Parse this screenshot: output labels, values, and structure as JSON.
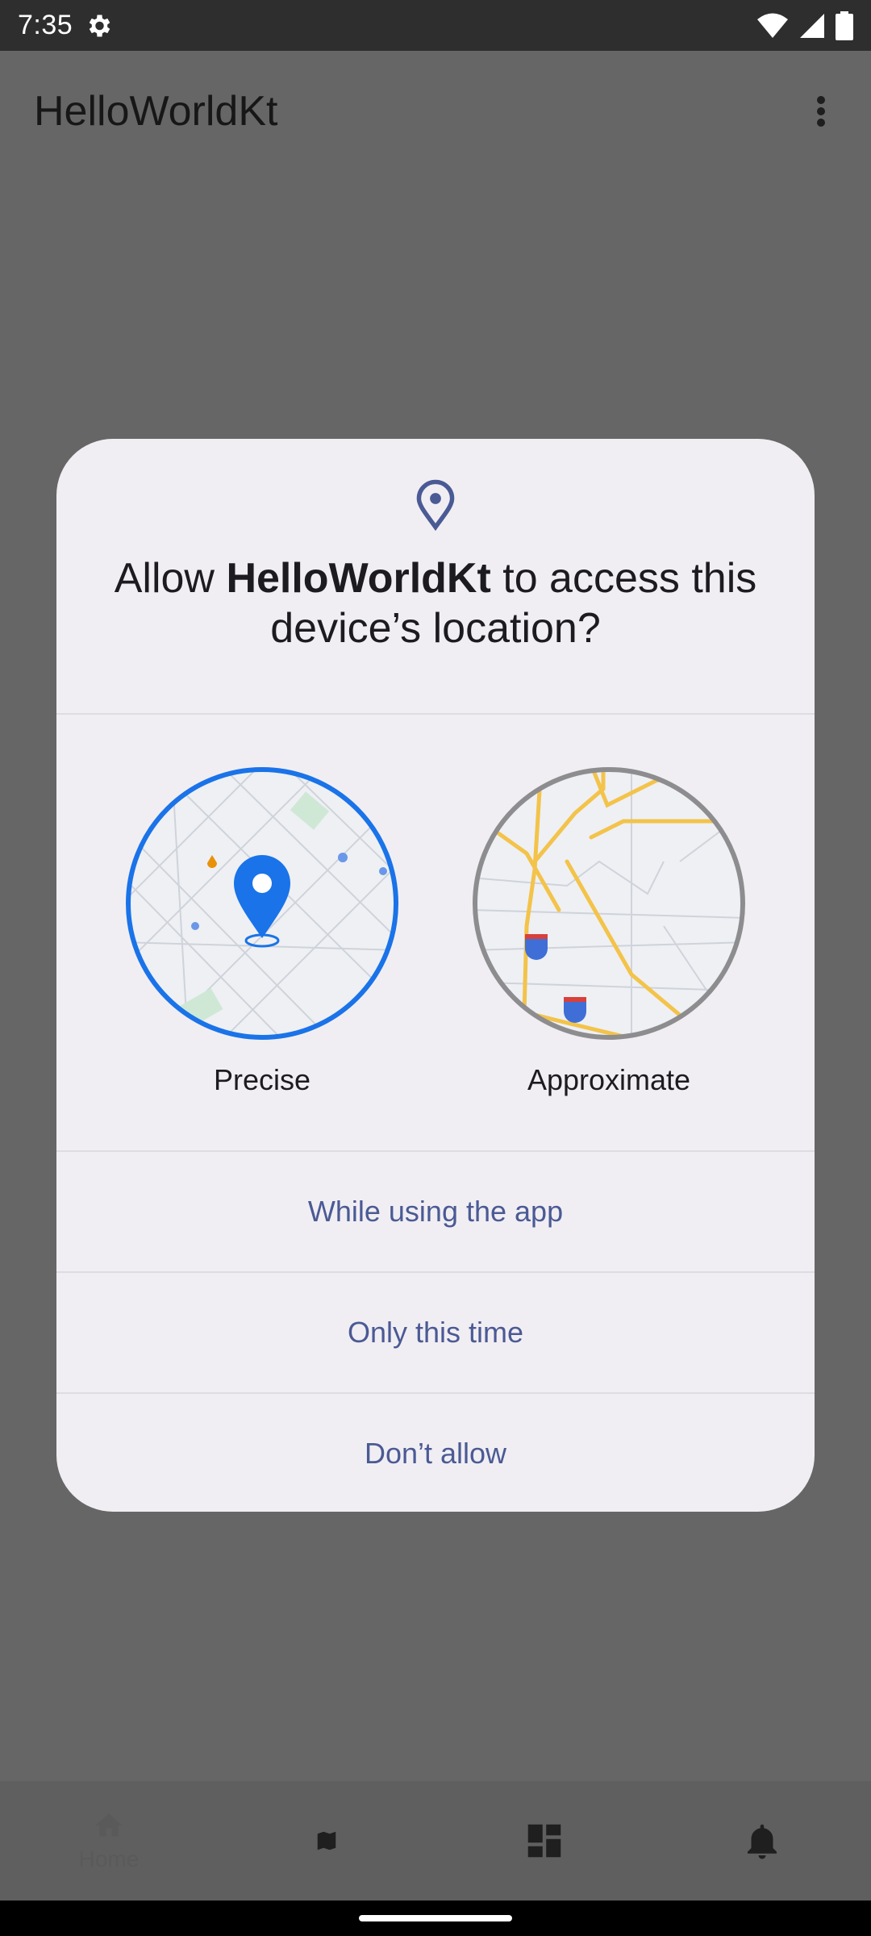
{
  "status_bar": {
    "time": "7:35"
  },
  "app_bar": {
    "title": "HelloWorldKt"
  },
  "dialog": {
    "title_prefix": "Allow ",
    "title_app": "HelloWorldKt",
    "title_suffix": " to access this device’s location?",
    "options": [
      {
        "label": "Precise"
      },
      {
        "label": "Approximate"
      }
    ],
    "actions": [
      {
        "label": "While using the app"
      },
      {
        "label": "Only this time"
      },
      {
        "label": "Don’t allow"
      }
    ]
  },
  "bottom_nav": {
    "items": [
      {
        "label": "Home"
      }
    ]
  },
  "colors": {
    "accent": "#1a73e8",
    "action_text": "#4a5a94",
    "scrim": "#666666",
    "dialog_bg": "#f1eef3"
  }
}
